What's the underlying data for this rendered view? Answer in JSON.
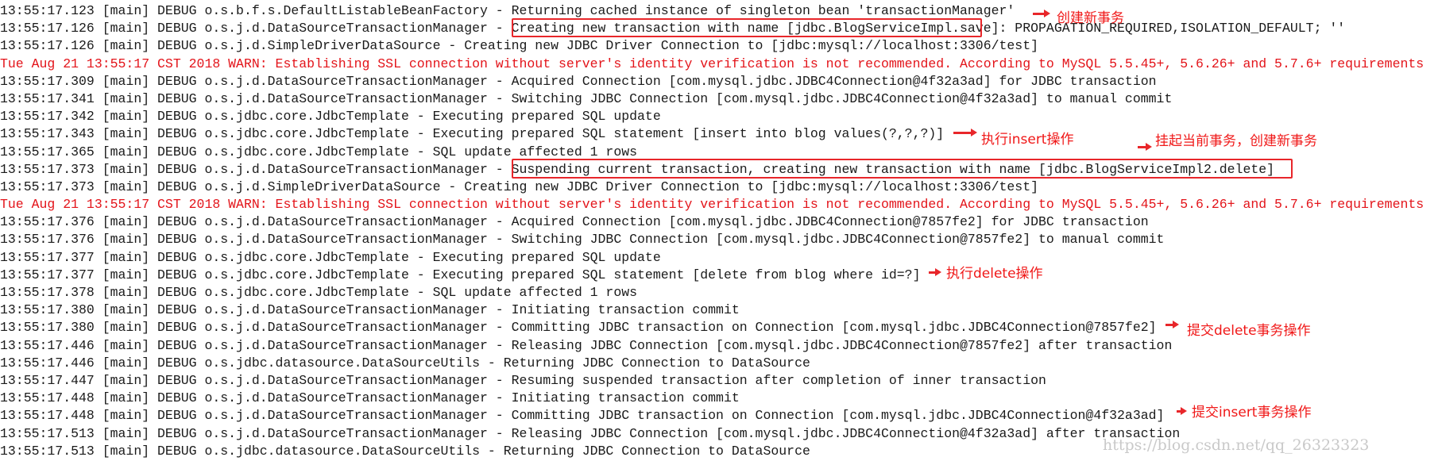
{
  "colors": {
    "warn_text": "#e3141a",
    "annotation": "#f01818",
    "box": "#e8262a"
  },
  "log_lines": [
    {
      "level": "debug",
      "text": "13:55:17.123 [main] DEBUG o.s.b.f.s.DefaultListableBeanFactory - Returning cached instance of singleton bean 'transactionManager'"
    },
    {
      "level": "debug",
      "text": "13:55:17.126 [main] DEBUG o.s.j.d.DataSourceTransactionManager - Creating new transaction with name [jdbc.BlogServiceImpl.save]: PROPAGATION_REQUIRED,ISOLATION_DEFAULT; ''"
    },
    {
      "level": "debug",
      "text": "13:55:17.126 [main] DEBUG o.s.j.d.SimpleDriverDataSource - Creating new JDBC Driver Connection to [jdbc:mysql://localhost:3306/test]"
    },
    {
      "level": "warn",
      "text": "Tue Aug 21 13:55:17 CST 2018 WARN: Establishing SSL connection without server's identity verification is not recommended. According to MySQL 5.5.45+, 5.6.26+ and 5.7.6+ requirements"
    },
    {
      "level": "debug",
      "text": "13:55:17.309 [main] DEBUG o.s.j.d.DataSourceTransactionManager - Acquired Connection [com.mysql.jdbc.JDBC4Connection@4f32a3ad] for JDBC transaction"
    },
    {
      "level": "debug",
      "text": "13:55:17.341 [main] DEBUG o.s.j.d.DataSourceTransactionManager - Switching JDBC Connection [com.mysql.jdbc.JDBC4Connection@4f32a3ad] to manual commit"
    },
    {
      "level": "debug",
      "text": "13:55:17.342 [main] DEBUG o.s.jdbc.core.JdbcTemplate - Executing prepared SQL update"
    },
    {
      "level": "debug",
      "text": "13:55:17.343 [main] DEBUG o.s.jdbc.core.JdbcTemplate - Executing prepared SQL statement [insert into blog values(?,?,?)]"
    },
    {
      "level": "debug",
      "text": "13:55:17.365 [main] DEBUG o.s.jdbc.core.JdbcTemplate - SQL update affected 1 rows"
    },
    {
      "level": "debug",
      "text": "13:55:17.373 [main] DEBUG o.s.j.d.DataSourceTransactionManager - Suspending current transaction, creating new transaction with name [jdbc.BlogServiceImpl2.delete]"
    },
    {
      "level": "debug",
      "text": "13:55:17.373 [main] DEBUG o.s.j.d.SimpleDriverDataSource - Creating new JDBC Driver Connection to [jdbc:mysql://localhost:3306/test]"
    },
    {
      "level": "warn",
      "text": "Tue Aug 21 13:55:17 CST 2018 WARN: Establishing SSL connection without server's identity verification is not recommended. According to MySQL 5.5.45+, 5.6.26+ and 5.7.6+ requirements"
    },
    {
      "level": "debug",
      "text": "13:55:17.376 [main] DEBUG o.s.j.d.DataSourceTransactionManager - Acquired Connection [com.mysql.jdbc.JDBC4Connection@7857fe2] for JDBC transaction"
    },
    {
      "level": "debug",
      "text": "13:55:17.376 [main] DEBUG o.s.j.d.DataSourceTransactionManager - Switching JDBC Connection [com.mysql.jdbc.JDBC4Connection@7857fe2] to manual commit"
    },
    {
      "level": "debug",
      "text": "13:55:17.377 [main] DEBUG o.s.jdbc.core.JdbcTemplate - Executing prepared SQL update"
    },
    {
      "level": "debug",
      "text": "13:55:17.377 [main] DEBUG o.s.jdbc.core.JdbcTemplate - Executing prepared SQL statement [delete from blog where id=?]"
    },
    {
      "level": "debug",
      "text": "13:55:17.378 [main] DEBUG o.s.jdbc.core.JdbcTemplate - SQL update affected 1 rows"
    },
    {
      "level": "debug",
      "text": "13:55:17.380 [main] DEBUG o.s.j.d.DataSourceTransactionManager - Initiating transaction commit"
    },
    {
      "level": "debug",
      "text": "13:55:17.380 [main] DEBUG o.s.j.d.DataSourceTransactionManager - Committing JDBC transaction on Connection [com.mysql.jdbc.JDBC4Connection@7857fe2]"
    },
    {
      "level": "debug",
      "text": "13:55:17.446 [main] DEBUG o.s.j.d.DataSourceTransactionManager - Releasing JDBC Connection [com.mysql.jdbc.JDBC4Connection@7857fe2] after transaction"
    },
    {
      "level": "debug",
      "text": "13:55:17.446 [main] DEBUG o.s.jdbc.datasource.DataSourceUtils - Returning JDBC Connection to DataSource"
    },
    {
      "level": "debug",
      "text": "13:55:17.447 [main] DEBUG o.s.j.d.DataSourceTransactionManager - Resuming suspended transaction after completion of inner transaction"
    },
    {
      "level": "debug",
      "text": "13:55:17.448 [main] DEBUG o.s.j.d.DataSourceTransactionManager - Initiating transaction commit"
    },
    {
      "level": "debug",
      "text": "13:55:17.448 [main] DEBUG o.s.j.d.DataSourceTransactionManager - Committing JDBC transaction on Connection [com.mysql.jdbc.JDBC4Connection@4f32a3ad]"
    },
    {
      "level": "debug",
      "text": "13:55:17.513 [main] DEBUG o.s.j.d.DataSourceTransactionManager - Releasing JDBC Connection [com.mysql.jdbc.JDBC4Connection@4f32a3ad] after transaction"
    },
    {
      "level": "debug",
      "text": "13:55:17.513 [main] DEBUG o.s.jdbc.datasource.DataSourceUtils - Returning JDBC Connection to DataSource"
    }
  ],
  "annotations": {
    "create_tx": "创建新事务",
    "exec_insert": "执行insert操作",
    "suspend_create": "挂起当前事务，创建新事务",
    "exec_delete": "执行delete操作",
    "commit_delete": "提交delete事务操作",
    "commit_insert": "提交insert事务操作"
  },
  "watermark": "https://blog.csdn.net/qq_26323323"
}
